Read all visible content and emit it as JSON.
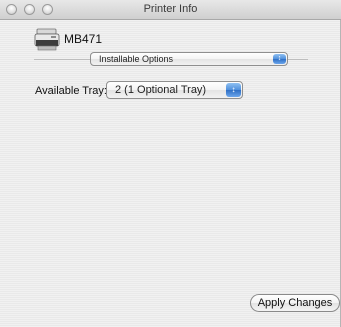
{
  "window": {
    "title": "Printer Info"
  },
  "printer": {
    "model": "MB471",
    "icon": "printer-icon"
  },
  "section_popup": {
    "selected": "Installable Options",
    "icon": "popup-arrows-icon"
  },
  "tray": {
    "label": "Available Tray:",
    "selected": "2 (1 Optional Tray)",
    "icon": "popup-arrows-icon"
  },
  "actions": {
    "apply_label": "Apply Changes"
  },
  "colors": {
    "popup_accent": "#4f8fdc",
    "window_background": "#ececec"
  }
}
